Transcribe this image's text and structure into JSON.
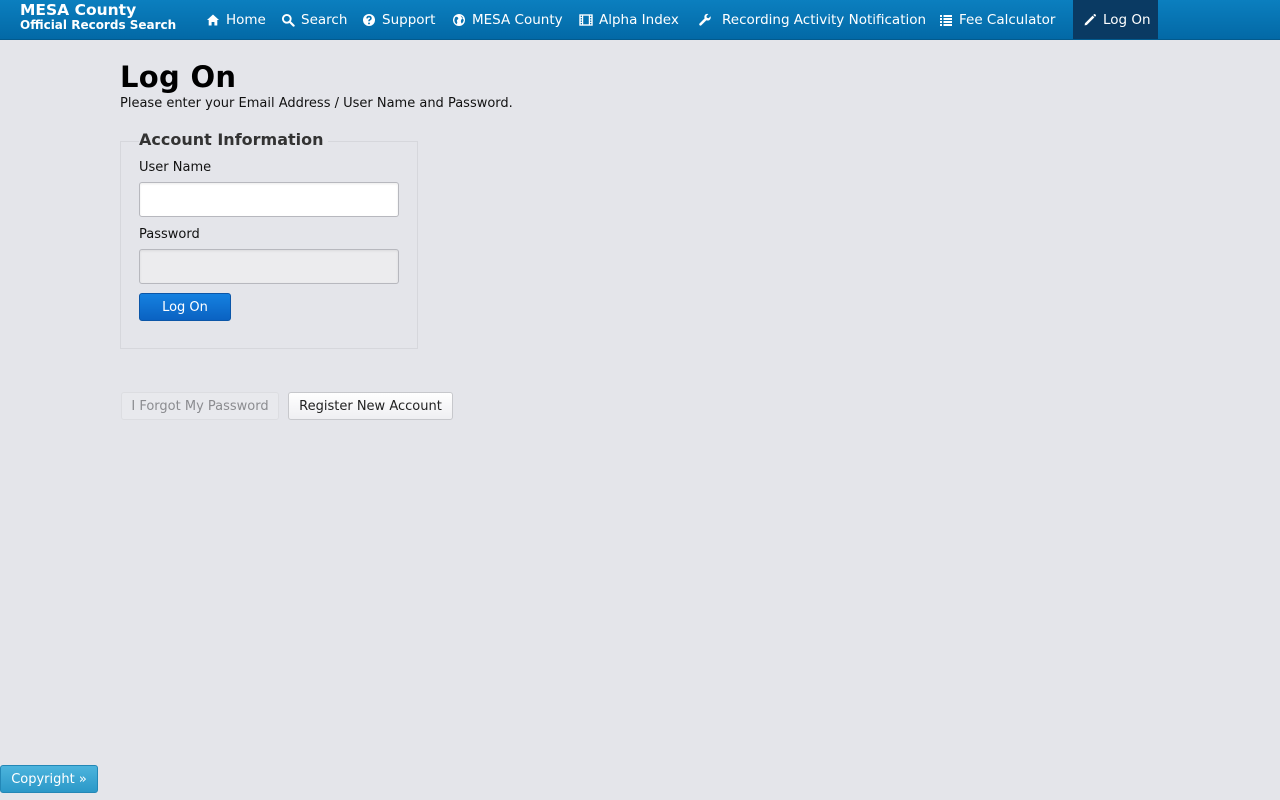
{
  "brand": {
    "title": "MESA County",
    "subtitle": "Official Records Search"
  },
  "nav": {
    "items": [
      {
        "label": "Home",
        "icon": "home-icon"
      },
      {
        "label": "Search",
        "icon": "search-icon"
      },
      {
        "label": "Support",
        "icon": "question-circle-icon"
      },
      {
        "label": "MESA County",
        "icon": "globe-icon"
      },
      {
        "label": "Alpha Index",
        "icon": "film-icon"
      },
      {
        "label": "Recording Activity Notification",
        "icon": "wrench-icon"
      },
      {
        "label": "Fee Calculator",
        "icon": "list-icon"
      },
      {
        "label": "Log On",
        "icon": "pencil-icon",
        "active": true
      }
    ]
  },
  "page": {
    "title": "Log On",
    "instructions": "Please enter your Email Address / User Name and Password."
  },
  "form": {
    "legend": "Account Information",
    "username_label": "User Name",
    "username_value": "",
    "password_label": "Password",
    "password_value": "",
    "submit_label": "Log On"
  },
  "actions": {
    "forgot_label": "I Forgot My Password",
    "register_label": "Register New Account"
  },
  "footer": {
    "copyright_label": "Copyright »"
  },
  "colors": {
    "navbar": "#0b7fbf",
    "navbar_active": "#0a3a63",
    "background": "#e4e5ea",
    "primary_button": "#1581e0",
    "copyright_button": "#3aa7d4"
  }
}
